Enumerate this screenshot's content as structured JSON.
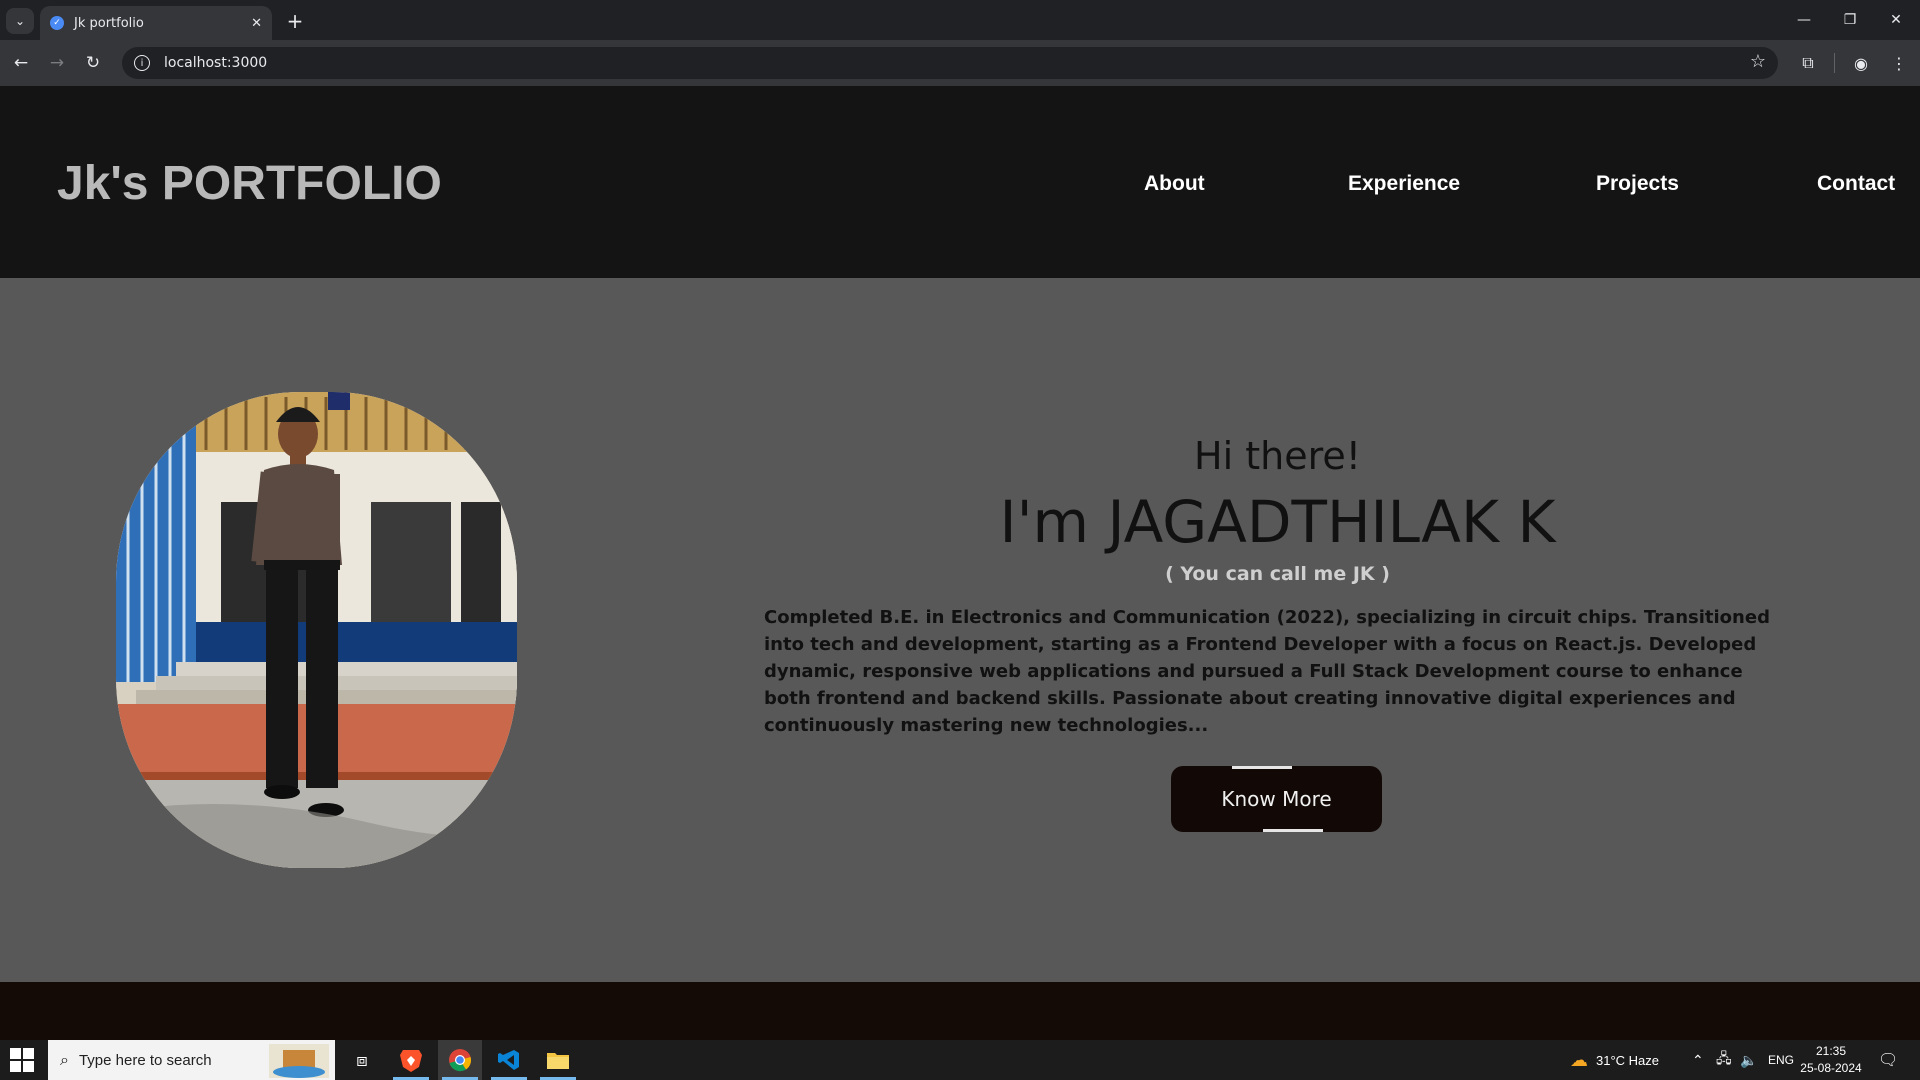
{
  "browser": {
    "tab_title": "Jk portfolio",
    "url": "localhost:3000"
  },
  "site": {
    "logo": "Jk's PORTFOLIO",
    "nav": [
      "About",
      "Experience",
      "Projects",
      "Contact"
    ]
  },
  "hero": {
    "greeting": "Hi there!",
    "name": "I'm JAGADTHILAK K",
    "nickname": "( You can call me JK )",
    "bio": "Completed B.E. in Electronics and Communication (2022), specializing in circuit chips. Transitioned into tech and development, starting as a Frontend Developer with a focus on React.js. Developed dynamic, responsive web applications and pursued a Full Stack Development course to enhance both frontend and backend skills. Passionate about creating innovative digital experiences and continuously mastering new technologies...",
    "cta_label": "Know More"
  },
  "taskbar": {
    "search_placeholder": "Type here to search",
    "weather": "31°C  Haze",
    "language": "ENG",
    "time": "21:35",
    "date": "25-08-2024"
  },
  "colors": {
    "header_bg": "#141414",
    "hero_bg": "#585858",
    "button_bg": "#120906",
    "footer_bg": "#140b06"
  }
}
